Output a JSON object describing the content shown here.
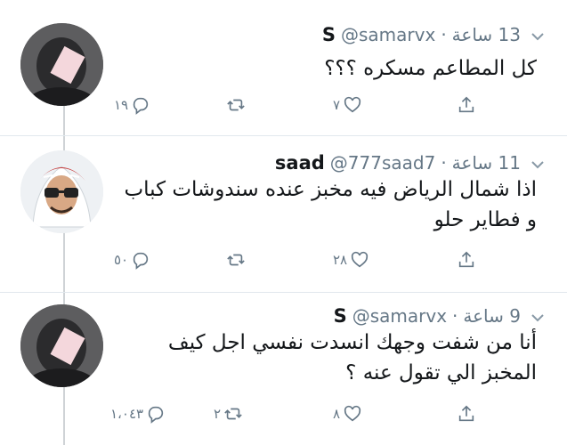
{
  "tweets": [
    {
      "name": "S",
      "handle": "@samarvx",
      "dot": "·",
      "time": "13 ساعة",
      "text_lines": [
        "كل المطاعم مسكره ؟؟؟"
      ],
      "reply_count": "١٩",
      "retweet_count": "",
      "like_count": "٧",
      "avatar_icon": "user-photo"
    },
    {
      "name": "saad",
      "handle": "@777saad7",
      "dot": "·",
      "time": "11 ساعة",
      "text_lines": [
        "اذا شمال الرياض فيه مخبز عنده سندوشات كباب",
        "و فطاير حلو"
      ],
      "reply_count": "٥٠",
      "retweet_count": "",
      "like_count": "٢٨",
      "avatar_icon": "user-photo-shemagh"
    },
    {
      "name": "S",
      "handle": "@samarvx",
      "dot": "·",
      "time": "9 ساعة",
      "text_lines": [
        "أنا من شفت وجهك انسدت نفسي اجل كيف",
        "المخبز الي تقول عنه ؟"
      ],
      "reply_count": "١،٠٤٣",
      "retweet_count": "٢",
      "like_count": "٨",
      "avatar_icon": "user-photo"
    }
  ],
  "colors": {
    "text": "#14171a",
    "muted": "#657786",
    "divider": "#e1e8ed",
    "thread": "#cfd3d6"
  },
  "icons": [
    "reply-icon",
    "retweet-icon",
    "like-icon",
    "share-icon",
    "chevron-down-icon"
  ]
}
